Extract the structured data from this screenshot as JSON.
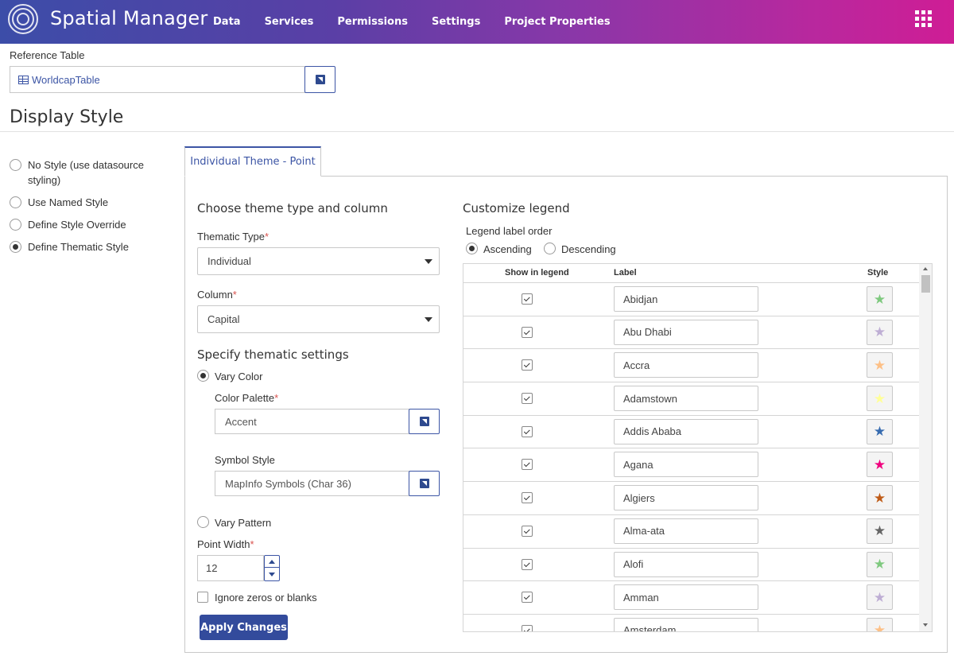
{
  "app": {
    "title": "Spatial Manager"
  },
  "nav": [
    "Data",
    "Services",
    "Permissions",
    "Settings",
    "Project Properties"
  ],
  "reference": {
    "label": "Reference Table",
    "value": "WorldcapTable"
  },
  "display_style": {
    "title": "Display Style",
    "options": [
      {
        "label": "No Style (use datasource styling)",
        "selected": false
      },
      {
        "label": "Use Named Style",
        "selected": false
      },
      {
        "label": "Define Style Override",
        "selected": false
      },
      {
        "label": "Define Thematic Style",
        "selected": true
      }
    ]
  },
  "tab": {
    "label": "Individual Theme - Point"
  },
  "theme": {
    "heading": "Choose theme type and column",
    "thematic_type_label": "Thematic Type",
    "thematic_type_value": "Individual",
    "column_label": "Column",
    "column_value": "Capital",
    "settings_heading": "Specify thematic settings",
    "vary_color_label": "Vary Color",
    "color_palette_label": "Color Palette",
    "color_palette_value": "Accent",
    "symbol_style_label": "Symbol Style",
    "symbol_style_value": "MapInfo Symbols (Char 36)",
    "vary_pattern_label": "Vary Pattern",
    "point_width_label": "Point Width",
    "point_width_value": "12",
    "ignore_zeros_label": "Ignore zeros or blanks",
    "apply_label": "Apply Changes",
    "required_mark": "*"
  },
  "legend": {
    "heading": "Customize legend",
    "order_label": "Legend label order",
    "ascending_label": "Ascending",
    "descending_label": "Descending",
    "col_show": "Show in legend",
    "col_label": "Label",
    "col_style": "Style",
    "rows": [
      {
        "label": "Abidjan",
        "color": "#7fc97f"
      },
      {
        "label": "Abu Dhabi",
        "color": "#beaed4"
      },
      {
        "label": "Accra",
        "color": "#fdc086"
      },
      {
        "label": "Adamstown",
        "color": "#ffff99"
      },
      {
        "label": "Addis Ababa",
        "color": "#386cb0"
      },
      {
        "label": "Agana",
        "color": "#f0027f"
      },
      {
        "label": "Algiers",
        "color": "#bf5b17"
      },
      {
        "label": "Alma-ata",
        "color": "#666666"
      },
      {
        "label": "Alofi",
        "color": "#7fc97f"
      },
      {
        "label": "Amman",
        "color": "#beaed4"
      },
      {
        "label": "Amsterdam",
        "color": "#fdc086"
      }
    ]
  }
}
